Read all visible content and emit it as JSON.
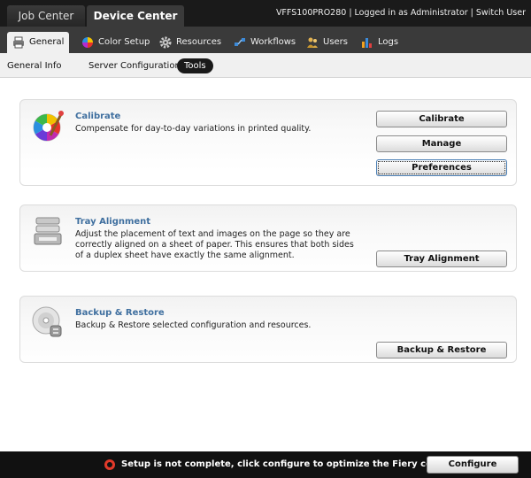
{
  "top": {
    "job_center": "Job Center",
    "device_center": "Device Center",
    "status": "VFFS100PRO280 | Logged in as Administrator | Switch User"
  },
  "tabs": [
    {
      "label": "General",
      "icon": "printer-icon"
    },
    {
      "label": "Color Setup",
      "icon": "color-wheel-icon"
    },
    {
      "label": "Resources",
      "icon": "gear-icon"
    },
    {
      "label": "Workflows",
      "icon": "workflow-icon"
    },
    {
      "label": "Users",
      "icon": "users-icon"
    },
    {
      "label": "Logs",
      "icon": "bar-chart-icon"
    }
  ],
  "subtabs": [
    "General Info",
    "Server Configuration",
    "Tools"
  ],
  "cards": {
    "calibrate": {
      "title": "Calibrate",
      "desc": "Compensate for day-to-day variations in printed quality.",
      "buttons": [
        "Calibrate",
        "Manage",
        "Preferences"
      ]
    },
    "tray": {
      "title": "Tray Alignment",
      "desc": "Adjust the placement of text and images on the page so they are correctly aligned on a sheet of paper. This ensures that both sides of a duplex sheet have exactly the same alignment.",
      "button": "Tray Alignment"
    },
    "backup": {
      "title": "Backup & Restore",
      "desc": "Backup & Restore selected configuration and resources.",
      "button": "Backup & Restore"
    }
  },
  "footer": {
    "message": "Setup is not complete, click configure to optimize the Fiery controller.",
    "configure": "Configure"
  },
  "colors": {
    "accent_title": "#3f6f9f",
    "warning": "#e23a2a"
  }
}
